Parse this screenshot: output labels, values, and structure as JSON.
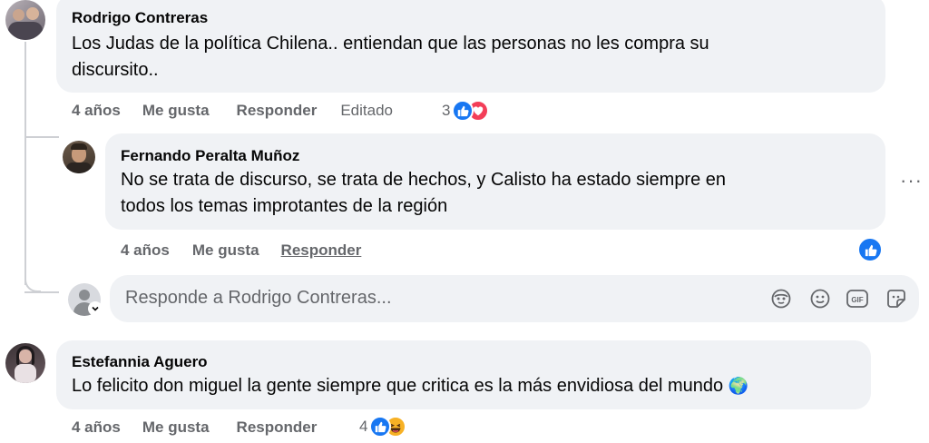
{
  "comments": [
    {
      "author": "Rodrigo Contreras",
      "text_line1": "Los Judas de la política Chilena.. entiendan que las personas no les compra su",
      "text_line2": "discursito..",
      "time": "4 años",
      "like": "Me gusta",
      "reply": "Responder",
      "edited": "Editado",
      "reaction_count": "3",
      "reactions": [
        "like-icon",
        "love-icon"
      ]
    },
    {
      "author": "Fernando Peralta Muñoz",
      "text_line1": "No se trata de discurso, se trata de hechos, y Calisto ha estado siempre en",
      "text_line2": "todos los temas improtantes de la región",
      "time": "4 años",
      "like": "Me gusta",
      "reply": "Responder",
      "reactions": [
        "like-icon"
      ],
      "more": "···"
    },
    {
      "author": "Estefannia Aguero",
      "text": "Lo felicito don miguel la gente siempre que critica es la más envidiosa del mundo",
      "emoji": "🌍",
      "time": "4 años",
      "like": "Me gusta",
      "reply": "Responder",
      "reaction_count": "4",
      "reactions": [
        "like-icon",
        "haha-icon"
      ]
    }
  ],
  "reply_box": {
    "placeholder": "Responde a Rodrigo Contreras...",
    "tools": [
      "avatar-sticker-icon",
      "emoji-icon",
      "gif-icon",
      "sticker-icon"
    ]
  },
  "colors": {
    "bubble": "#f0f2f5",
    "secondary_text": "#65676b",
    "like_blue": "#1877f2",
    "love_red": "#f33e58"
  }
}
